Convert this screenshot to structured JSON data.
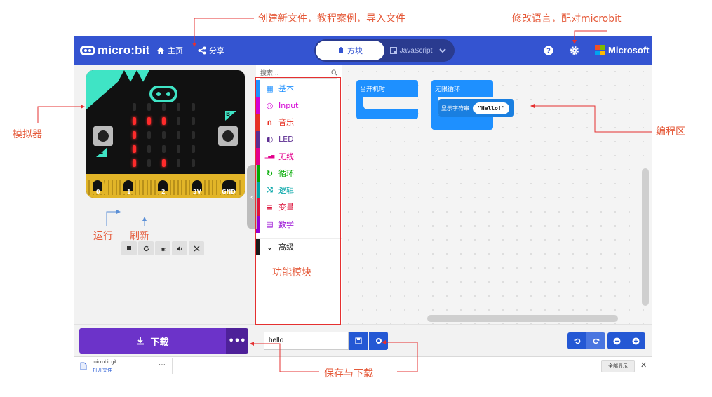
{
  "topbar": {
    "brand": "micro:bit",
    "home_label": "主页",
    "share_label": "分享",
    "mode_blocks": "方块",
    "mode_js": "JavaScript",
    "microsoft": "Microsoft",
    "accent": "#3454d1"
  },
  "simulator": {
    "pins": [
      "0",
      "1",
      "2",
      "3V",
      "GND"
    ],
    "button_a": "A",
    "button_b": "B",
    "controls": [
      "stop-icon",
      "restart-icon",
      "debug-icon",
      "sound-icon",
      "fullscreen-icon"
    ]
  },
  "toolbox": {
    "search_placeholder": "搜索...",
    "categories": [
      {
        "label": "基本",
        "color": "#1e90ff",
        "icon": "grid-icon"
      },
      {
        "label": "Input",
        "color": "#d400d4",
        "icon": "target-icon"
      },
      {
        "label": "音乐",
        "color": "#e63022",
        "icon": "headphones-icon"
      },
      {
        "label": "LED",
        "color": "#5c2d91",
        "icon": "toggle-icon"
      },
      {
        "label": "无线",
        "color": "#e3008c",
        "icon": "signal-icon"
      },
      {
        "label": "循环",
        "color": "#00aa00",
        "icon": "loop-icon"
      },
      {
        "label": "逻辑",
        "color": "#00a4a6",
        "icon": "shuffle-icon"
      },
      {
        "label": "变量",
        "color": "#dc143c",
        "icon": "list-icon"
      },
      {
        "label": "数学",
        "color": "#9400d3",
        "icon": "calculator-icon"
      }
    ],
    "advanced": "高级"
  },
  "workspace": {
    "on_start": "当开机时",
    "forever": "无限循环",
    "show_string": "显示字符串",
    "string_value": "\"Hello!\""
  },
  "bottom": {
    "download": "下载",
    "project_name": "hello"
  },
  "shelf": {
    "file_name": "microbit.gif",
    "open_file": "打开文件",
    "show_all": "全部显示"
  },
  "annotations": {
    "top_menu": "创建新文件，教程案例，导入文件",
    "settings": "修改语言，配对microbit",
    "simulator": "模拟器",
    "coding_area": "编程区",
    "run": "运行",
    "refresh": "刷新",
    "blocks": "功能模块",
    "save_download": "保存与下载",
    "color": "#e55a3a"
  }
}
